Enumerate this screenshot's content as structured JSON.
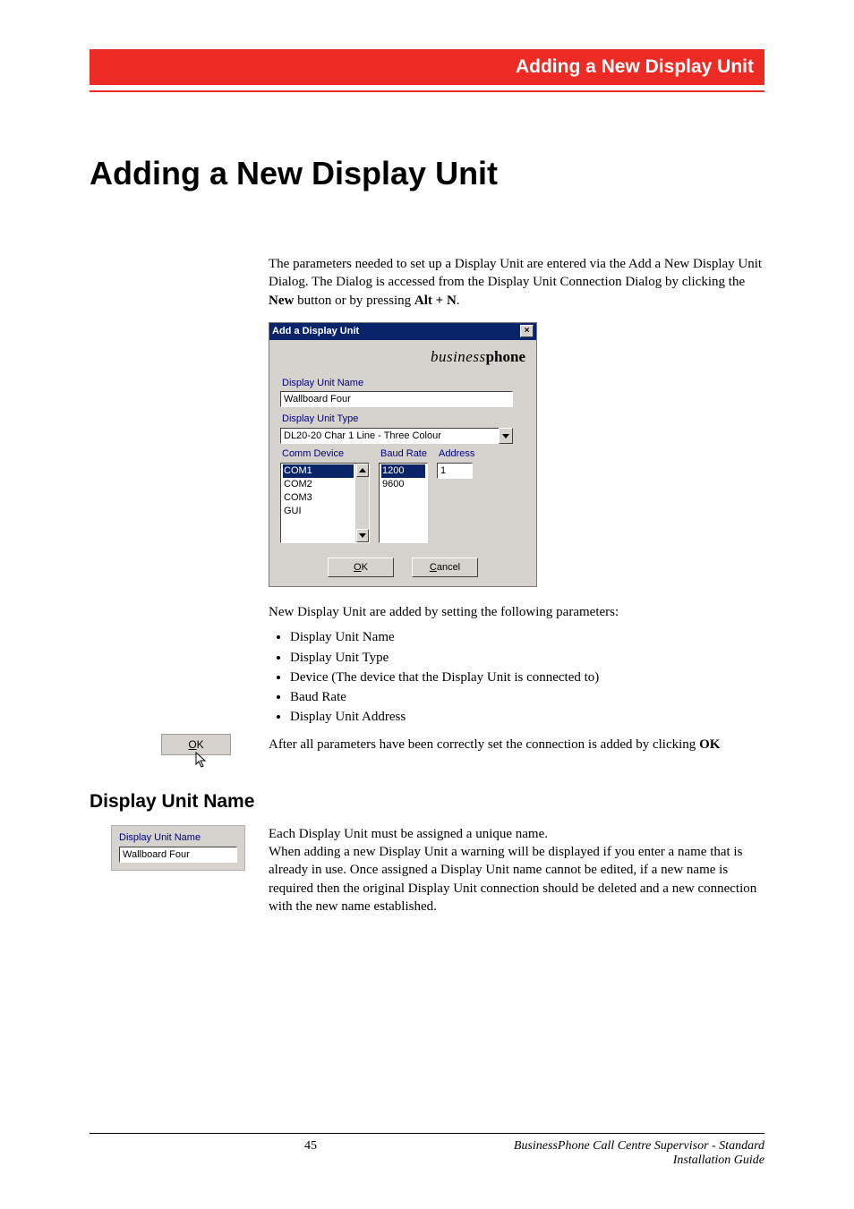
{
  "header": {
    "title": "Adding a New Display Unit"
  },
  "h1": "Adding a New Display Unit",
  "intro": {
    "p1a": "The parameters needed to set up a Display Unit are entered via the Add a New Display Unit Dialog. The Dialog is accessed from the Display Unit Connection Dialog by clicking the ",
    "p1b": "New",
    "p1c": " button or by pressing ",
    "p1d": "Alt + N",
    "p1e": "."
  },
  "dialog": {
    "title": "Add a Display Unit",
    "brand_a": "business",
    "brand_b": "phone",
    "name_label": "Display Unit Name",
    "name_value": "Wallboard Four",
    "type_label": "Display Unit Type",
    "type_value": "DL20-20 Char 1 Line - Three Colour",
    "comm_label": "Comm Device",
    "comm_items": [
      "COM1",
      "COM2",
      "COM3",
      "GUI"
    ],
    "comm_selected": "COM1",
    "baud_label": "Baud Rate",
    "baud_items": [
      "1200",
      "9600"
    ],
    "baud_selected": "1200",
    "address_label": "Address",
    "address_value": "1",
    "ok_u": "O",
    "ok_rest": "K",
    "cancel_u": "C",
    "cancel_rest": "ancel"
  },
  "after_dialog_lead": "New Display Unit are added by setting the following parameters:",
  "params": [
    "Display Unit Name",
    "Display Unit Type",
    "Device (The device that the Display Unit is connected to)",
    "Baud Rate",
    "Display Unit Address"
  ],
  "ok_para_a": "After all parameters have been correctly set the connection is added by clicking ",
  "ok_para_b": "OK",
  "section2_title": "Display Unit Name",
  "thumb2": {
    "label": "Display Unit Name",
    "value": "Wallboard Four"
  },
  "sec2_p1": "Each Display Unit must be assigned a unique name.",
  "sec2_p2": "When adding a new Display Unit a warning will be displayed if you enter a name that is already in use. Once assigned a Display Unit name cannot be edited, if a new name is required then the original Display Unit connection should be deleted and a new connection with the new name established.",
  "ok_thumb": {
    "u": "O",
    "rest": "K"
  },
  "footer": {
    "page": "45",
    "line1": "BusinessPhone Call Centre Supervisor - Standard",
    "line2": "Installation Guide"
  }
}
